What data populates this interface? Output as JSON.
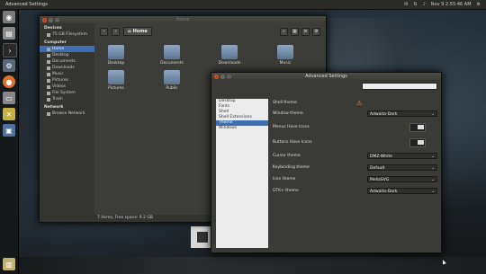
{
  "panel": {
    "title": "Advanced Settings",
    "clock": "Nov 9 2:55:46 AM"
  },
  "launcher": {
    "items": [
      {
        "name": "dash",
        "color": "#7a7a76"
      },
      {
        "name": "files",
        "color": "#8a8a8a"
      },
      {
        "name": "terminal",
        "color": "#2a2a2a"
      },
      {
        "name": "settings",
        "color": "#5a6a7a"
      },
      {
        "name": "ubuntu-software",
        "color": "#e07030"
      },
      {
        "name": "disk",
        "color": "#888888"
      },
      {
        "name": "tools",
        "color": "#c8b040"
      },
      {
        "name": "monitor",
        "color": "#5070a0"
      },
      {
        "name": "trash",
        "color": "#c0b070"
      }
    ]
  },
  "nautilus": {
    "title": "Home",
    "breadcrumb": "Home",
    "sidebar": {
      "devices_header": "Devices",
      "devices": [
        "75 GB Filesystem"
      ],
      "computer_header": "Computer",
      "computer": [
        "Home",
        "Desktop",
        "Documents",
        "Downloads",
        "Music",
        "Pictures",
        "Videos",
        "File System",
        "Trash"
      ],
      "network_header": "Network",
      "network": [
        "Browse Network"
      ]
    },
    "files": [
      "Desktop",
      "Documents",
      "Downloads",
      "Music",
      "Pictures",
      "Public"
    ],
    "status": "7 items, Free space: 9.2 GB"
  },
  "advanced": {
    "title": "Advanced Settings",
    "search_placeholder": "",
    "sidebar": [
      "Desktop",
      "Fonts",
      "Shell",
      "Shell Extensions",
      "Theme",
      "Windows"
    ],
    "selected": "Theme",
    "rows": {
      "shell_theme": "Shell theme",
      "window_theme": "Window theme",
      "window_theme_value": "Adwaita-Dark",
      "menus_icons": "Menus Have Icons",
      "buttons_icons": "Buttons Have Icons",
      "cursor_theme": "Cursor theme",
      "cursor_theme_value": "DMZ-White",
      "keybinding_theme": "Keybinding theme",
      "keybinding_theme_value": "Default",
      "icon_theme": "Icon theme",
      "icon_theme_value": "MeliaSVG",
      "gtk_theme": "GTK+ theme",
      "gtk_theme_value": "Adwaita-Dark"
    }
  }
}
